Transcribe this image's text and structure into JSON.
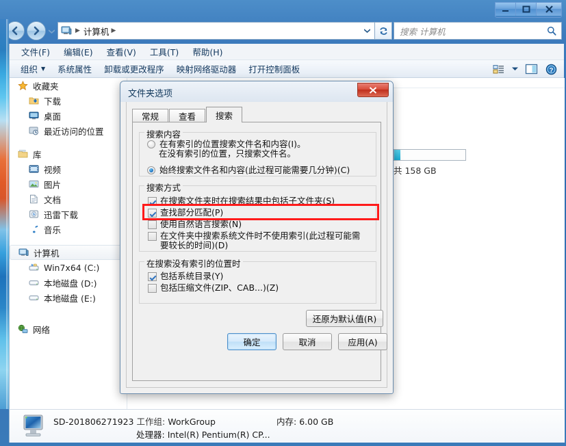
{
  "window": {
    "controls": {
      "minimize": "minimize-icon",
      "maximize": "maximize-icon",
      "close": "close-icon"
    }
  },
  "address": {
    "back": "back-icon",
    "forward": "forward-icon",
    "history_dropdown": "chevron-down-icon",
    "crumb_icon": "computer-icon",
    "crumb": "计算机",
    "sep": "▶",
    "dropdown": "chevron-down-icon",
    "refresh": "refresh-icon",
    "search_placeholder": "搜索 计算机",
    "search_value": "",
    "search_icon": "search-icon"
  },
  "menubar": {
    "items": [
      {
        "label": "文件(F)"
      },
      {
        "label": "编辑(E)"
      },
      {
        "label": "查看(V)"
      },
      {
        "label": "工具(T)"
      },
      {
        "label": "帮助(H)"
      }
    ]
  },
  "toolbar": {
    "items": [
      {
        "label": "组织",
        "caret": "▼"
      },
      {
        "label": "系统属性"
      },
      {
        "label": "卸载或更改程序"
      },
      {
        "label": "映射网络驱动器"
      },
      {
        "label": "打开控制面板"
      }
    ],
    "view_icon": "view-list-icon",
    "view_caret": "▼",
    "preview_icon": "preview-pane-icon",
    "help_icon": "help-icon"
  },
  "navpane": {
    "groups": [
      {
        "header": {
          "label": "收藏夹",
          "icon": "star-icon"
        },
        "items": [
          {
            "label": "下载",
            "icon": "downloads-folder-icon"
          },
          {
            "label": "桌面",
            "icon": "desktop-icon"
          },
          {
            "label": "最近访问的位置",
            "icon": "recent-places-icon"
          }
        ]
      },
      {
        "header": {
          "label": "库",
          "icon": "library-icon"
        },
        "items": [
          {
            "label": "视频",
            "icon": "videos-icon"
          },
          {
            "label": "图片",
            "icon": "pictures-icon"
          },
          {
            "label": "文档",
            "icon": "documents-icon"
          },
          {
            "label": "迅雷下载",
            "icon": "thunder-download-icon"
          },
          {
            "label": "音乐",
            "icon": "music-icon"
          }
        ]
      },
      {
        "header": {
          "label": "计算机",
          "icon": "computer-icon",
          "selected": true
        },
        "items": [
          {
            "label": "Win7x64 (C:)",
            "icon": "system-drive-icon"
          },
          {
            "label": "本地磁盘 (D:)",
            "icon": "drive-icon"
          },
          {
            "label": "本地磁盘 (E:)",
            "icon": "drive-icon"
          }
        ]
      },
      {
        "header": {
          "label": "网络",
          "icon": "network-icon"
        },
        "items": []
      }
    ]
  },
  "content": {
    "disk_capacity_text": "共 158 GB"
  },
  "statusbar": {
    "computer_icon": "computer-large-icon",
    "computer_name": "SD-201806271923",
    "workgroup_label": "工作组:",
    "workgroup_value": "WorkGroup",
    "memory_label": "内存:",
    "memory_value": "6.00 GB",
    "processor_label": "处理器:",
    "processor_value": "Intel(R) Pentium(R) CP..."
  },
  "dialog": {
    "title": "文件夹选项",
    "close_label": "✕",
    "tabs": [
      {
        "label": "常规",
        "active": false
      },
      {
        "label": "查看",
        "active": false
      },
      {
        "label": "搜索",
        "active": true
      }
    ],
    "group_content": {
      "legend": "搜索内容",
      "options": [
        {
          "line1": "在有索引的位置搜索文件名和内容(I)。",
          "line2": "在没有索引的位置，只搜索文件名。",
          "checked": false
        },
        {
          "line1": "始终搜索文件名和内容(此过程可能需要几分钟)(C)",
          "line2": "",
          "checked": true,
          "highlighted": true
        }
      ]
    },
    "group_method": {
      "legend": "搜索方式",
      "checkboxes": [
        {
          "label": "在搜索文件夹时在搜索结果中包括子文件夹(S)",
          "checked": true
        },
        {
          "label": "查找部分匹配(P)",
          "checked": true
        },
        {
          "label": "使用自然语言搜索(N)",
          "checked": false
        },
        {
          "label": "在文件夹中搜索系统文件时不使用索引(此过程可能需要较长的时间)(D)",
          "checked": false
        }
      ]
    },
    "group_noindex": {
      "legend": "在搜索没有索引的位置时",
      "checkboxes": [
        {
          "label": "包括系统目录(Y)",
          "checked": true
        },
        {
          "label": "包括压缩文件(ZIP、CAB...)(Z)",
          "checked": false
        }
      ]
    },
    "buttons": {
      "restore_defaults": "还原为默认值(R)",
      "ok": "确定",
      "cancel": "取消",
      "apply": "应用(A)"
    },
    "highlight_color": "#ff1a1a"
  }
}
